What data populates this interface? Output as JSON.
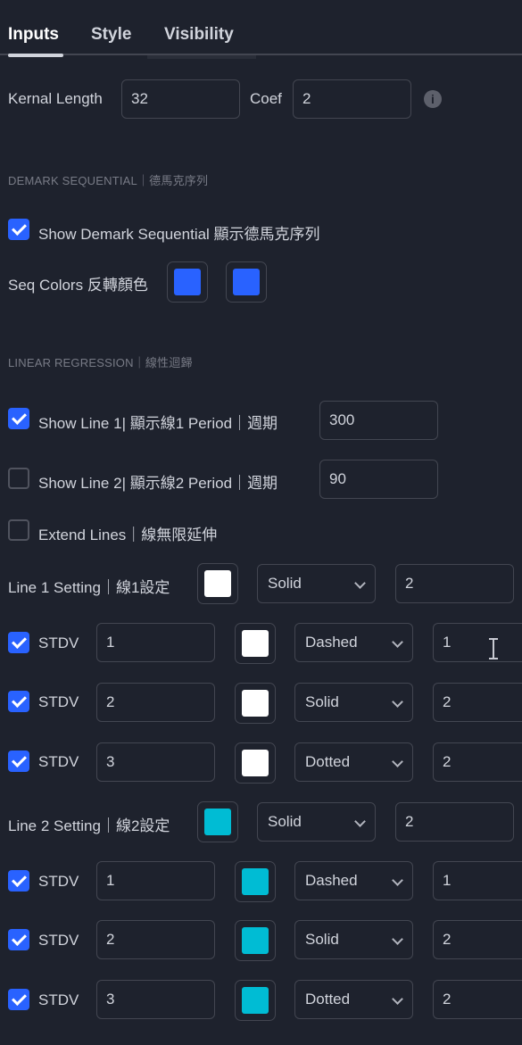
{
  "tabs": [
    {
      "label": "Inputs",
      "active": true
    },
    {
      "label": "Style",
      "active": false
    },
    {
      "label": "Visibility",
      "active": false
    }
  ],
  "kernal": {
    "label": "Kernal Length",
    "value": "32",
    "coef_label": "Coef",
    "coef_value": "2",
    "info_icon": "info-icon"
  },
  "demark": {
    "section": "DEMARK SEQUENTIAL｜德馬克序列",
    "show": {
      "checked": true,
      "label": "Show Demark Sequential 顯示德馬克序列"
    },
    "colors_label": "Seq Colors 反轉顏色",
    "colors": [
      "#2962ff",
      "#2962ff"
    ]
  },
  "linreg": {
    "section": "LINEAR REGRESSION｜線性迴歸",
    "line1": {
      "checked": true,
      "label": "Show Line 1| 顯示線1  Period｜週期",
      "period": "300"
    },
    "line2": {
      "checked": false,
      "label": "Show Line 2| 顯示線2  Period｜週期",
      "period": "90"
    },
    "extend": {
      "checked": false,
      "label": "Extend Lines｜線無限延伸"
    }
  },
  "line1_setting": {
    "label": "Line 1 Setting｜線1設定",
    "color": "#ffffff",
    "style": "Solid",
    "width": "2",
    "stdv": [
      {
        "checked": true,
        "label": "STDV",
        "mult": "1",
        "color": "#ffffff",
        "style": "Dashed",
        "width": "1"
      },
      {
        "checked": true,
        "label": "STDV",
        "mult": "2",
        "color": "#ffffff",
        "style": "Solid",
        "width": "2"
      },
      {
        "checked": true,
        "label": "STDV",
        "mult": "3",
        "color": "#ffffff",
        "style": "Dotted",
        "width": "2"
      }
    ]
  },
  "line2_setting": {
    "label": "Line 2 Setting｜線2設定",
    "color": "#00bcd4",
    "style": "Solid",
    "width": "2",
    "stdv": [
      {
        "checked": true,
        "label": "STDV",
        "mult": "1",
        "color": "#00bcd4",
        "style": "Dashed",
        "width": "1"
      },
      {
        "checked": true,
        "label": "STDV",
        "mult": "2",
        "color": "#00bcd4",
        "style": "Solid",
        "width": "2"
      },
      {
        "checked": true,
        "label": "STDV",
        "mult": "3",
        "color": "#00bcd4",
        "style": "Dotted",
        "width": "2"
      }
    ]
  }
}
